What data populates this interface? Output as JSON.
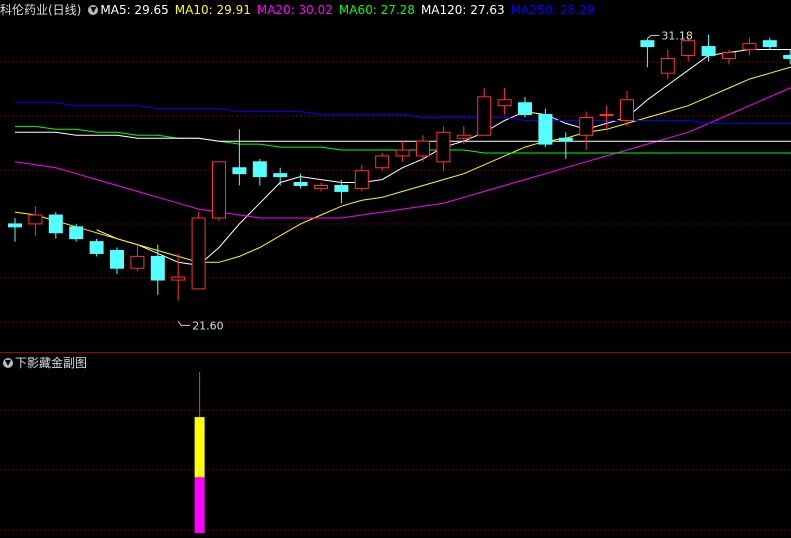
{
  "main_header": {
    "title": "科伦药业(日线)",
    "ma": [
      {
        "label": "MA5: 29.65",
        "color": "#ffffff"
      },
      {
        "label": "MA10: 29.91",
        "color": "#ffff00"
      },
      {
        "label": "MA20: 30.02",
        "color": "#ff00ff"
      },
      {
        "label": "MA60: 27.28",
        "color": "#00ff00"
      },
      {
        "label": "MA120: 27.63",
        "color": "#ffffff"
      },
      {
        "label": "MA250: 28.29",
        "color": "#0000ff"
      }
    ]
  },
  "sub_header": {
    "title": "下影藏金副图"
  },
  "annotations": {
    "high_label": "31.18",
    "low_label": "21.60",
    "high_value": 31.18,
    "low_value": 21.6
  },
  "colors": {
    "up": "#ff3232",
    "down": "#54ffff",
    "grid": "#800000",
    "sub_yellow": "#ffff00",
    "sub_magenta": "#ff00ff"
  },
  "chart_data": {
    "type": "candlestick",
    "ylim": [
      20.7,
      31.8
    ],
    "candles": [
      {
        "o": 24.9,
        "c": 24.8,
        "h": 25.1,
        "l": 24.3
      },
      {
        "o": 24.9,
        "c": 25.2,
        "h": 25.5,
        "l": 24.5
      },
      {
        "o": 25.2,
        "c": 24.6,
        "h": 25.3,
        "l": 24.4
      },
      {
        "o": 24.8,
        "c": 24.4,
        "h": 24.9,
        "l": 24.3
      },
      {
        "o": 24.3,
        "c": 23.9,
        "h": 24.4,
        "l": 23.8
      },
      {
        "o": 24.0,
        "c": 23.4,
        "h": 24.1,
        "l": 23.2
      },
      {
        "o": 23.4,
        "c": 23.8,
        "h": 24.2,
        "l": 23.3
      },
      {
        "o": 23.8,
        "c": 23.0,
        "h": 24.2,
        "l": 22.5
      },
      {
        "o": 23.0,
        "c": 23.1,
        "h": 23.9,
        "l": 22.3
      },
      {
        "o": 22.7,
        "c": 25.1,
        "h": 25.3,
        "l": 22.7
      },
      {
        "o": 25.1,
        "c": 27.0,
        "h": 27.0,
        "l": 25.0
      },
      {
        "o": 26.8,
        "c": 26.6,
        "h": 28.1,
        "l": 26.2
      },
      {
        "o": 27.0,
        "c": 26.5,
        "h": 27.1,
        "l": 26.2
      },
      {
        "o": 26.6,
        "c": 26.5,
        "h": 26.8,
        "l": 26.2
      },
      {
        "o": 26.3,
        "c": 26.2,
        "h": 26.6,
        "l": 26.1
      },
      {
        "o": 26.1,
        "c": 26.2,
        "h": 26.3,
        "l": 26.0
      },
      {
        "o": 26.2,
        "c": 26.0,
        "h": 26.4,
        "l": 25.6
      },
      {
        "o": 26.1,
        "c": 26.7,
        "h": 26.9,
        "l": 26.0
      },
      {
        "o": 26.8,
        "c": 27.2,
        "h": 27.3,
        "l": 26.7
      },
      {
        "o": 27.2,
        "c": 27.4,
        "h": 27.7,
        "l": 27.0
      },
      {
        "o": 27.2,
        "c": 27.7,
        "h": 27.9,
        "l": 27.0
      },
      {
        "o": 27.0,
        "c": 28.0,
        "h": 28.2,
        "l": 26.7
      },
      {
        "o": 27.8,
        "c": 27.9,
        "h": 28.2,
        "l": 27.6
      },
      {
        "o": 27.9,
        "c": 29.2,
        "h": 29.5,
        "l": 27.9
      },
      {
        "o": 28.9,
        "c": 29.1,
        "h": 29.5,
        "l": 28.6
      },
      {
        "o": 29.0,
        "c": 28.6,
        "h": 29.2,
        "l": 28.5
      },
      {
        "o": 28.6,
        "c": 27.6,
        "h": 28.8,
        "l": 27.5
      },
      {
        "o": 27.8,
        "c": 27.7,
        "h": 28.0,
        "l": 27.1
      },
      {
        "o": 27.9,
        "c": 28.5,
        "h": 28.7,
        "l": 27.4
      },
      {
        "o": 28.6,
        "c": 28.6,
        "h": 28.9,
        "l": 28.1
      },
      {
        "o": 28.4,
        "c": 29.1,
        "h": 29.4,
        "l": 28.2
      },
      {
        "o": 31.1,
        "c": 30.9,
        "h": 31.18,
        "l": 30.2
      },
      {
        "o": 30.0,
        "c": 30.5,
        "h": 30.8,
        "l": 29.8
      },
      {
        "o": 30.6,
        "c": 31.1,
        "h": 31.2,
        "l": 30.4
      },
      {
        "o": 30.9,
        "c": 30.6,
        "h": 31.3,
        "l": 30.4
      },
      {
        "o": 30.5,
        "c": 30.7,
        "h": 30.8,
        "l": 30.3
      },
      {
        "o": 30.8,
        "c": 31.0,
        "h": 31.2,
        "l": 30.6
      },
      {
        "o": 31.1,
        "c": 30.9,
        "h": 31.2,
        "l": 30.8
      },
      {
        "o": 30.6,
        "c": 30.5,
        "h": 30.8,
        "l": 30.3
      },
      {
        "o": 30.7,
        "c": 30.5,
        "h": 30.8,
        "l": 30.0
      }
    ],
    "ma_lines": [
      {
        "name": "MA5",
        "color": "#ffffff",
        "values": [
          null,
          null,
          null,
          null,
          24.7,
          24.4,
          24.2,
          23.9,
          23.6,
          23.5,
          24.1,
          24.9,
          25.6,
          26.3,
          26.5,
          26.4,
          26.3,
          26.3,
          26.4,
          26.8,
          27.1,
          27.5,
          27.7,
          28.0,
          28.4,
          28.7,
          28.6,
          28.3,
          28.1,
          28.3,
          28.5,
          29.1,
          29.6,
          30.1,
          30.6,
          30.7,
          30.8,
          30.8,
          30.8,
          30.7
        ]
      },
      {
        "name": "MA10",
        "color": "#ffff00",
        "values": [
          25.3,
          25.2,
          25.0,
          24.8,
          24.6,
          24.4,
          24.2,
          24.0,
          23.8,
          23.6,
          23.6,
          23.8,
          24.1,
          24.5,
          24.9,
          25.2,
          25.5,
          25.7,
          25.8,
          26.0,
          26.2,
          26.4,
          26.6,
          26.9,
          27.2,
          27.5,
          27.7,
          27.8,
          28.0,
          28.1,
          28.3,
          28.5,
          28.7,
          28.9,
          29.2,
          29.5,
          29.8,
          30.0,
          30.2,
          30.3
        ]
      },
      {
        "name": "MA20",
        "color": "#ff00ff",
        "values": [
          27.0,
          26.9,
          26.8,
          26.6,
          26.4,
          26.2,
          26.0,
          25.8,
          25.6,
          25.4,
          25.3,
          25.2,
          25.1,
          25.1,
          25.1,
          25.1,
          25.1,
          25.2,
          25.3,
          25.4,
          25.5,
          25.6,
          25.8,
          26.0,
          26.2,
          26.4,
          26.6,
          26.8,
          27.0,
          27.2,
          27.4,
          27.6,
          27.8,
          28.0,
          28.3,
          28.6,
          28.9,
          29.2,
          29.5,
          29.7
        ]
      },
      {
        "name": "MA60",
        "color": "#00ff00",
        "values": [
          28.2,
          28.2,
          28.1,
          28.1,
          28.0,
          28.0,
          27.9,
          27.9,
          27.8,
          27.8,
          27.7,
          27.6,
          27.6,
          27.5,
          27.5,
          27.5,
          27.4,
          27.4,
          27.4,
          27.4,
          27.4,
          27.4,
          27.4,
          27.3,
          27.3,
          27.3,
          27.3,
          27.3,
          27.3,
          27.3,
          27.3,
          27.3,
          27.3,
          27.3,
          27.3,
          27.3,
          27.3,
          27.3,
          27.3,
          27.3
        ]
      },
      {
        "name": "MA120",
        "color": "#ffffff",
        "values": [
          28.0,
          28.0,
          28.0,
          27.9,
          27.9,
          27.9,
          27.8,
          27.8,
          27.8,
          27.8,
          27.7,
          27.7,
          27.7,
          27.7,
          27.7,
          27.7,
          27.7,
          27.7,
          27.7,
          27.7,
          27.7,
          27.7,
          27.7,
          27.7,
          27.7,
          27.7,
          27.7,
          27.7,
          27.7,
          27.7,
          27.7,
          27.7,
          27.7,
          27.7,
          27.7,
          27.7,
          27.7,
          27.7,
          27.7,
          27.7
        ]
      },
      {
        "name": "MA250",
        "color": "#0000ff",
        "values": [
          29.0,
          29.0,
          29.0,
          28.9,
          28.9,
          28.9,
          28.9,
          28.8,
          28.8,
          28.8,
          28.8,
          28.7,
          28.7,
          28.7,
          28.7,
          28.6,
          28.6,
          28.6,
          28.6,
          28.6,
          28.5,
          28.5,
          28.5,
          28.5,
          28.5,
          28.4,
          28.4,
          28.4,
          28.4,
          28.4,
          28.4,
          28.4,
          28.4,
          28.4,
          28.3,
          28.3,
          28.3,
          28.3,
          28.3,
          28.3
        ]
      }
    ],
    "sub_bar": {
      "index": 9,
      "magenta": 0.48,
      "yellow": 0.52,
      "wick": 0.28
    }
  }
}
